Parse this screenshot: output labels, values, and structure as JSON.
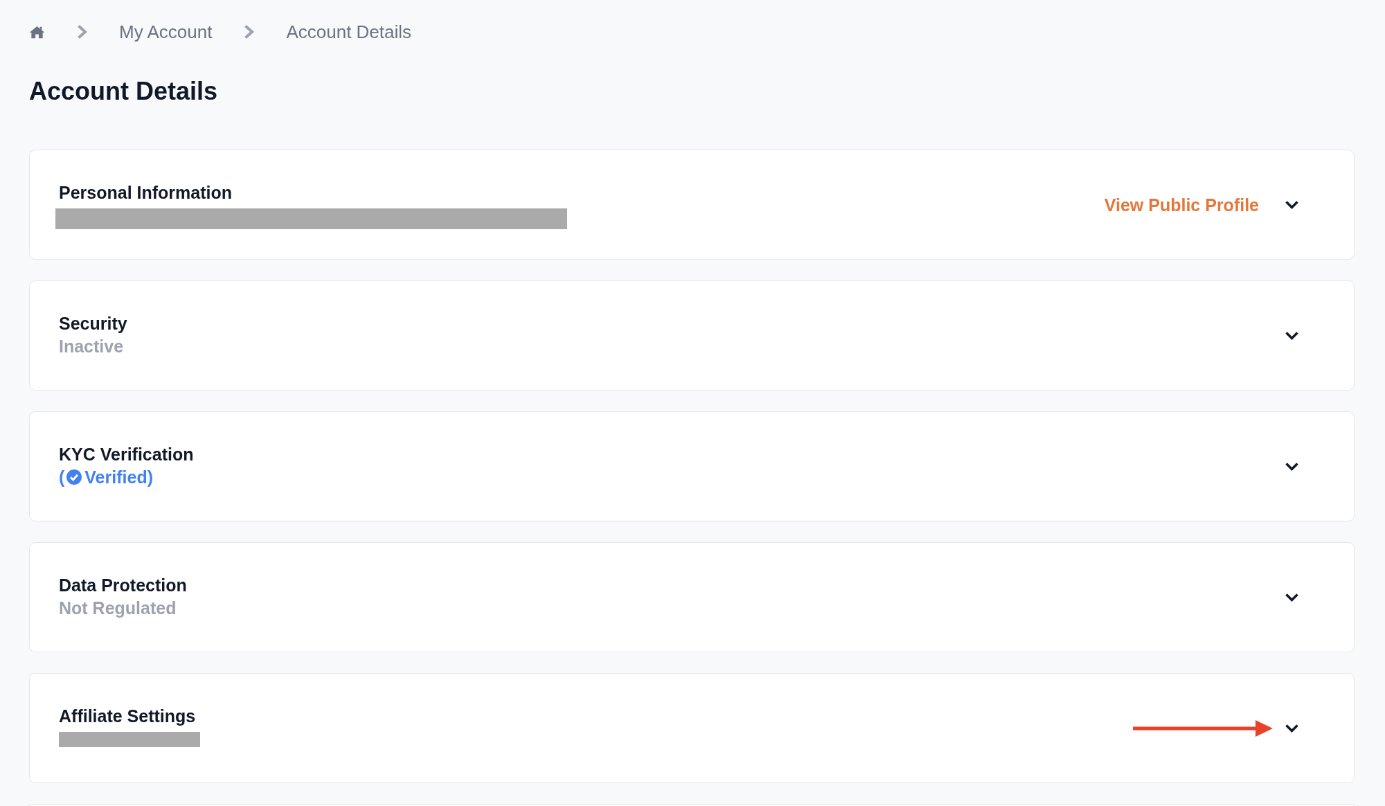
{
  "breadcrumb": {
    "items": [
      {
        "kind": "home"
      },
      {
        "kind": "link",
        "label": "My Account"
      },
      {
        "kind": "current",
        "label": "Account Details"
      }
    ]
  },
  "title": "Account Details",
  "sections": [
    {
      "title": "Personal Information",
      "status": {
        "kind": "redacted"
      },
      "link": "View Public Profile",
      "arrow_marker": false,
      "expanded": false
    },
    {
      "title": "Security",
      "status": {
        "kind": "text",
        "text": "Inactive"
      },
      "arrow_marker": false,
      "expanded": false
    },
    {
      "title": "KYC Verification",
      "status": {
        "kind": "verified",
        "prefix": "(",
        "text": "Verified)"
      },
      "arrow_marker": false,
      "expanded": false
    },
    {
      "title": "Data Protection",
      "status": {
        "kind": "text",
        "text": "Not Regulated"
      },
      "arrow_marker": false,
      "expanded": false
    },
    {
      "title": "Affiliate Settings",
      "status": {
        "kind": "redacted"
      },
      "arrow_marker": true,
      "expanded": false
    }
  ]
}
